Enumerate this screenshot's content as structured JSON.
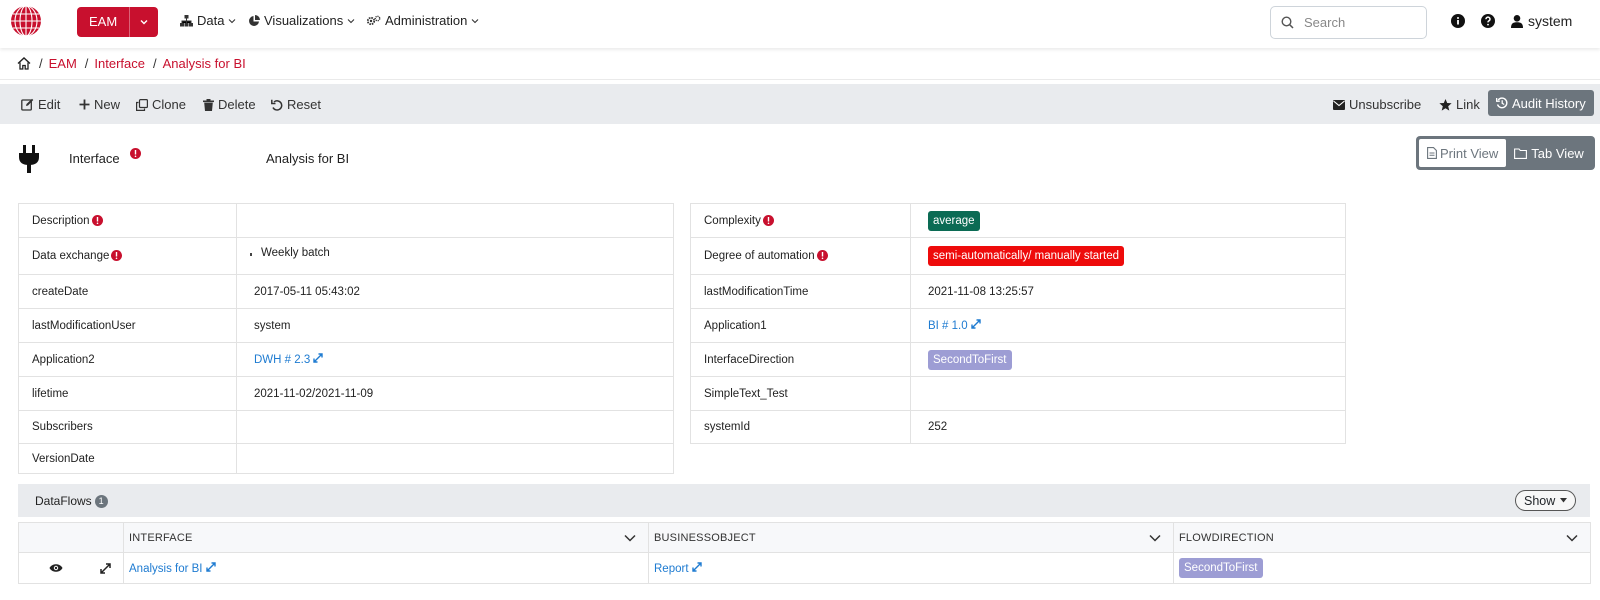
{
  "nav": {
    "brand_button": "EAM",
    "menus": [
      {
        "label": "Data",
        "icon": "sitemap-icon"
      },
      {
        "label": "Visualizations",
        "icon": "chart-pie-icon"
      },
      {
        "label": "Administration",
        "icon": "gears-icon"
      }
    ],
    "search_placeholder": "Search",
    "user": "system"
  },
  "breadcrumb": {
    "items": [
      "EAM",
      "Interface",
      "Analysis for BI"
    ]
  },
  "toolbar": {
    "edit": "Edit",
    "new": "New",
    "clone": "Clone",
    "delete": "Delete",
    "reset": "Reset",
    "unsubscribe": "Unsubscribe",
    "link": "Link",
    "audit_history": "Audit History"
  },
  "header": {
    "type": "Interface",
    "name": "Analysis for BI",
    "print_view": "Print View",
    "tab_view": "Tab View"
  },
  "left_props": [
    {
      "key": "Description",
      "value": "",
      "info": true
    },
    {
      "key": "Data exchange",
      "value": "Weekly batch",
      "info": true,
      "bullet": true
    },
    {
      "key": "createDate",
      "value": "2017-05-11 05:43:02"
    },
    {
      "key": "lastModificationUser",
      "value": "system"
    },
    {
      "key": "Application2",
      "value": "DWH # 2.3",
      "link": true
    },
    {
      "key": "lifetime",
      "value": "2021-11-02/2021-11-09"
    },
    {
      "key": "Subscribers",
      "value": ""
    },
    {
      "key": "VersionDate",
      "value": ""
    }
  ],
  "right_props": [
    {
      "key": "Complexity",
      "value": "average",
      "info": true,
      "badge": "#0b6b54"
    },
    {
      "key": "Degree of automation",
      "value": "semi-automatically/ manually started",
      "info": true,
      "badge": "#ee0b0b"
    },
    {
      "key": "lastModificationTime",
      "value": "2021-11-08 13:25:57"
    },
    {
      "key": "Application1",
      "value": "BI # 1.0",
      "link": true
    },
    {
      "key": "InterfaceDirection",
      "value": "SecondToFirst",
      "badge": "#9d9dd4"
    },
    {
      "key": "SimpleText_Test",
      "value": ""
    },
    {
      "key": "systemId",
      "value": "252"
    }
  ],
  "dataflows": {
    "title": "DataFlows",
    "count": "1",
    "show_label": "Show",
    "columns": [
      "INTERFACE",
      "BUSINESSOBJECT",
      "FLOWDIRECTION"
    ],
    "rows": [
      {
        "interface": "Analysis for BI",
        "businessobject": "Report",
        "flowdirection": "SecondToFirst"
      }
    ]
  },
  "colors": {
    "brand": "#c8102e",
    "link": "#1e7bd1",
    "toolbar_bg": "#e9ebee"
  }
}
